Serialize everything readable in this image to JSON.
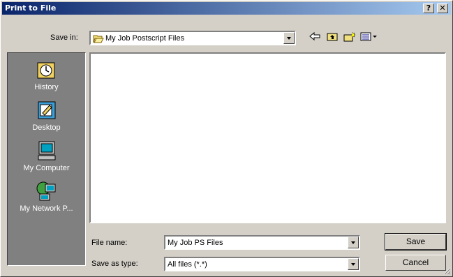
{
  "window": {
    "title": "Print to File",
    "help_label": "?",
    "close_label": "✕"
  },
  "toolbar": {
    "save_in_label": "Save in:",
    "save_in_value": "My Job Postscript Files"
  },
  "places": [
    {
      "label": "History",
      "icon": "history-icon"
    },
    {
      "label": "Desktop",
      "icon": "desktop-icon"
    },
    {
      "label": "My Computer",
      "icon": "my-computer-icon"
    },
    {
      "label": "My Network P...",
      "icon": "network-places-icon"
    }
  ],
  "form": {
    "file_name_label": "File name:",
    "file_name_value": "My Job PS Files",
    "save_as_type_label": "Save as type:",
    "save_as_type_value": "All files (*.*)"
  },
  "buttons": {
    "save": "Save",
    "cancel": "Cancel"
  },
  "colors": {
    "title_start": "#0a246a",
    "title_end": "#a6caf0",
    "face": "#d4d0c8",
    "sidebar": "#808080"
  }
}
